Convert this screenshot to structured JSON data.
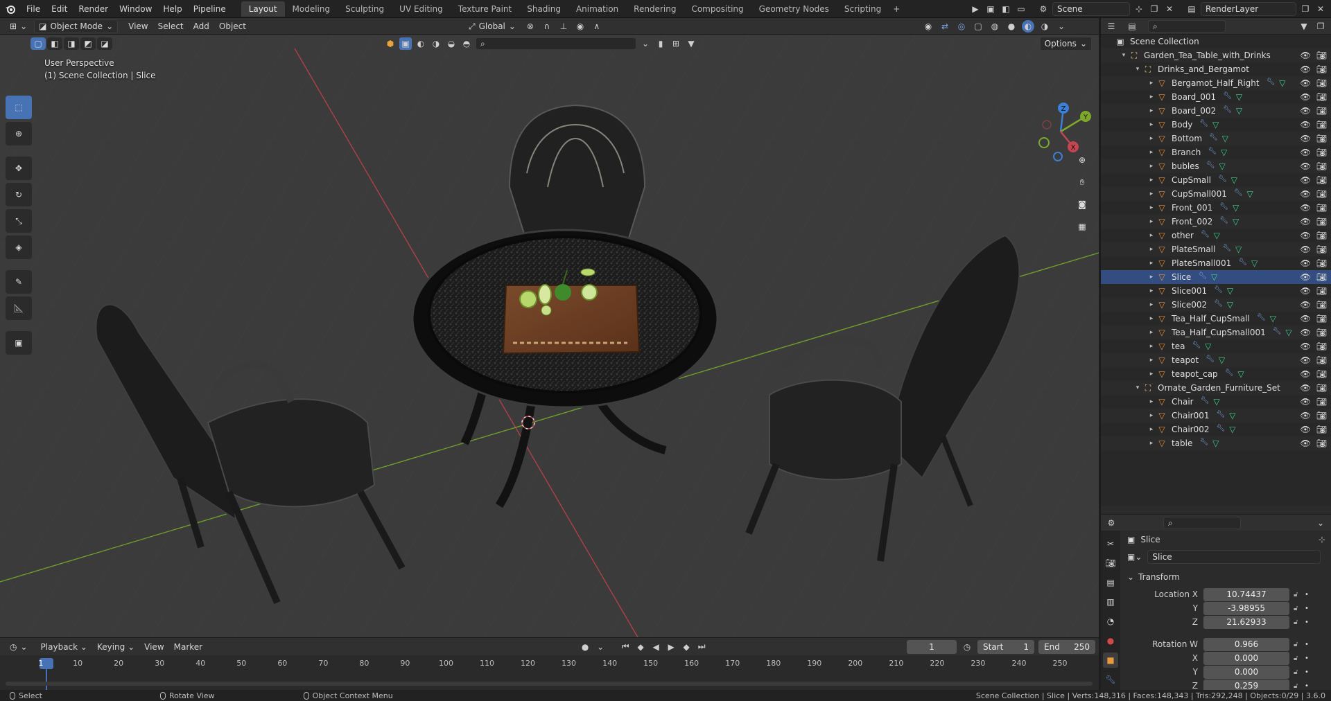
{
  "topbar": {
    "menus": [
      "File",
      "Edit",
      "Render",
      "Window",
      "Help",
      "Pipeline"
    ],
    "workspaces": [
      "Layout",
      "Modeling",
      "Sculpting",
      "UV Editing",
      "Texture Paint",
      "Shading",
      "Animation",
      "Rendering",
      "Compositing",
      "Geometry Nodes",
      "Scripting"
    ],
    "active_workspace": "Layout",
    "scene": "Scene",
    "view_layer": "RenderLayer"
  },
  "viewport": {
    "mode": "Object Mode",
    "menus": [
      "View",
      "Select",
      "Add",
      "Object"
    ],
    "orientation": "Global",
    "options_label": "Options",
    "perspective_label": "User Perspective",
    "context_label": "(1) Scene Collection | Slice",
    "gizmo_axes": {
      "x": "X",
      "y": "Y",
      "z": "Z"
    },
    "colors": {
      "x_axis": "#c44550",
      "y_axis": "#7da82b",
      "z_axis": "#3b7fd6",
      "background": "#3b3b3b"
    }
  },
  "outliner": {
    "rows": [
      {
        "depth": 0,
        "label": "Scene Collection",
        "type": "scene",
        "expanded": true
      },
      {
        "depth": 1,
        "label": "Garden_Tea_Table_with_Drinks",
        "type": "collection",
        "expanded": true
      },
      {
        "depth": 2,
        "label": "Drinks_and_Bergamot",
        "type": "collection",
        "expanded": true
      },
      {
        "depth": 3,
        "label": "Bergamot_Half_Right",
        "type": "mesh"
      },
      {
        "depth": 3,
        "label": "Board_001",
        "type": "mesh"
      },
      {
        "depth": 3,
        "label": "Board_002",
        "type": "mesh"
      },
      {
        "depth": 3,
        "label": "Body",
        "type": "mesh"
      },
      {
        "depth": 3,
        "label": "Bottom",
        "type": "mesh"
      },
      {
        "depth": 3,
        "label": "Branch",
        "type": "mesh"
      },
      {
        "depth": 3,
        "label": "bubles",
        "type": "mesh"
      },
      {
        "depth": 3,
        "label": "CupSmall",
        "type": "mesh"
      },
      {
        "depth": 3,
        "label": "CupSmall001",
        "type": "mesh"
      },
      {
        "depth": 3,
        "label": "Front_001",
        "type": "mesh"
      },
      {
        "depth": 3,
        "label": "Front_002",
        "type": "mesh"
      },
      {
        "depth": 3,
        "label": "other",
        "type": "mesh"
      },
      {
        "depth": 3,
        "label": "PlateSmall",
        "type": "mesh"
      },
      {
        "depth": 3,
        "label": "PlateSmall001",
        "type": "mesh"
      },
      {
        "depth": 3,
        "label": "Slice",
        "type": "mesh",
        "selected": true
      },
      {
        "depth": 3,
        "label": "Slice001",
        "type": "mesh"
      },
      {
        "depth": 3,
        "label": "Slice002",
        "type": "mesh"
      },
      {
        "depth": 3,
        "label": "Tea_Half_CupSmall",
        "type": "mesh"
      },
      {
        "depth": 3,
        "label": "Tea_Half_CupSmall001",
        "type": "mesh"
      },
      {
        "depth": 3,
        "label": "tea",
        "type": "mesh"
      },
      {
        "depth": 3,
        "label": "teapot",
        "type": "mesh"
      },
      {
        "depth": 3,
        "label": "teapot_cap",
        "type": "mesh"
      },
      {
        "depth": 2,
        "label": "Ornate_Garden_Furniture_Set",
        "type": "collection",
        "expanded": true
      },
      {
        "depth": 3,
        "label": "Chair",
        "type": "mesh"
      },
      {
        "depth": 3,
        "label": "Chair001",
        "type": "mesh"
      },
      {
        "depth": 3,
        "label": "Chair002",
        "type": "mesh"
      },
      {
        "depth": 3,
        "label": "table",
        "type": "mesh"
      }
    ]
  },
  "properties": {
    "object_name": "Slice",
    "data_name": "Slice",
    "panel": "Transform",
    "fields": [
      {
        "label": "Location X",
        "value": "10.74437"
      },
      {
        "label": "Y",
        "value": "-3.98955"
      },
      {
        "label": "Z",
        "value": "21.62933"
      },
      {
        "label": "Rotation W",
        "value": "0.966"
      },
      {
        "label": "X",
        "value": "0.000"
      },
      {
        "label": "Y",
        "value": "0.000"
      },
      {
        "label": "Z",
        "value": "0.259"
      }
    ]
  },
  "timeline": {
    "menus": [
      "Playback",
      "Keying",
      "View",
      "Marker"
    ],
    "current_frame": "1",
    "start_label": "Start",
    "start": "1",
    "end_label": "End",
    "end": "250",
    "ticks": [
      "1",
      "10",
      "20",
      "30",
      "40",
      "50",
      "60",
      "70",
      "80",
      "90",
      "100",
      "110",
      "120",
      "130",
      "140",
      "150",
      "160",
      "170",
      "180",
      "190",
      "200",
      "210",
      "220",
      "230",
      "240",
      "250"
    ]
  },
  "statusbar": {
    "select": "Select",
    "rotate": "Rotate View",
    "context_menu": "Object Context Menu",
    "info": "Scene Collection | Slice | Verts:148,316 | Faces:148,343 | Tris:292,248 | Objects:0/29 | 3.6.0"
  }
}
